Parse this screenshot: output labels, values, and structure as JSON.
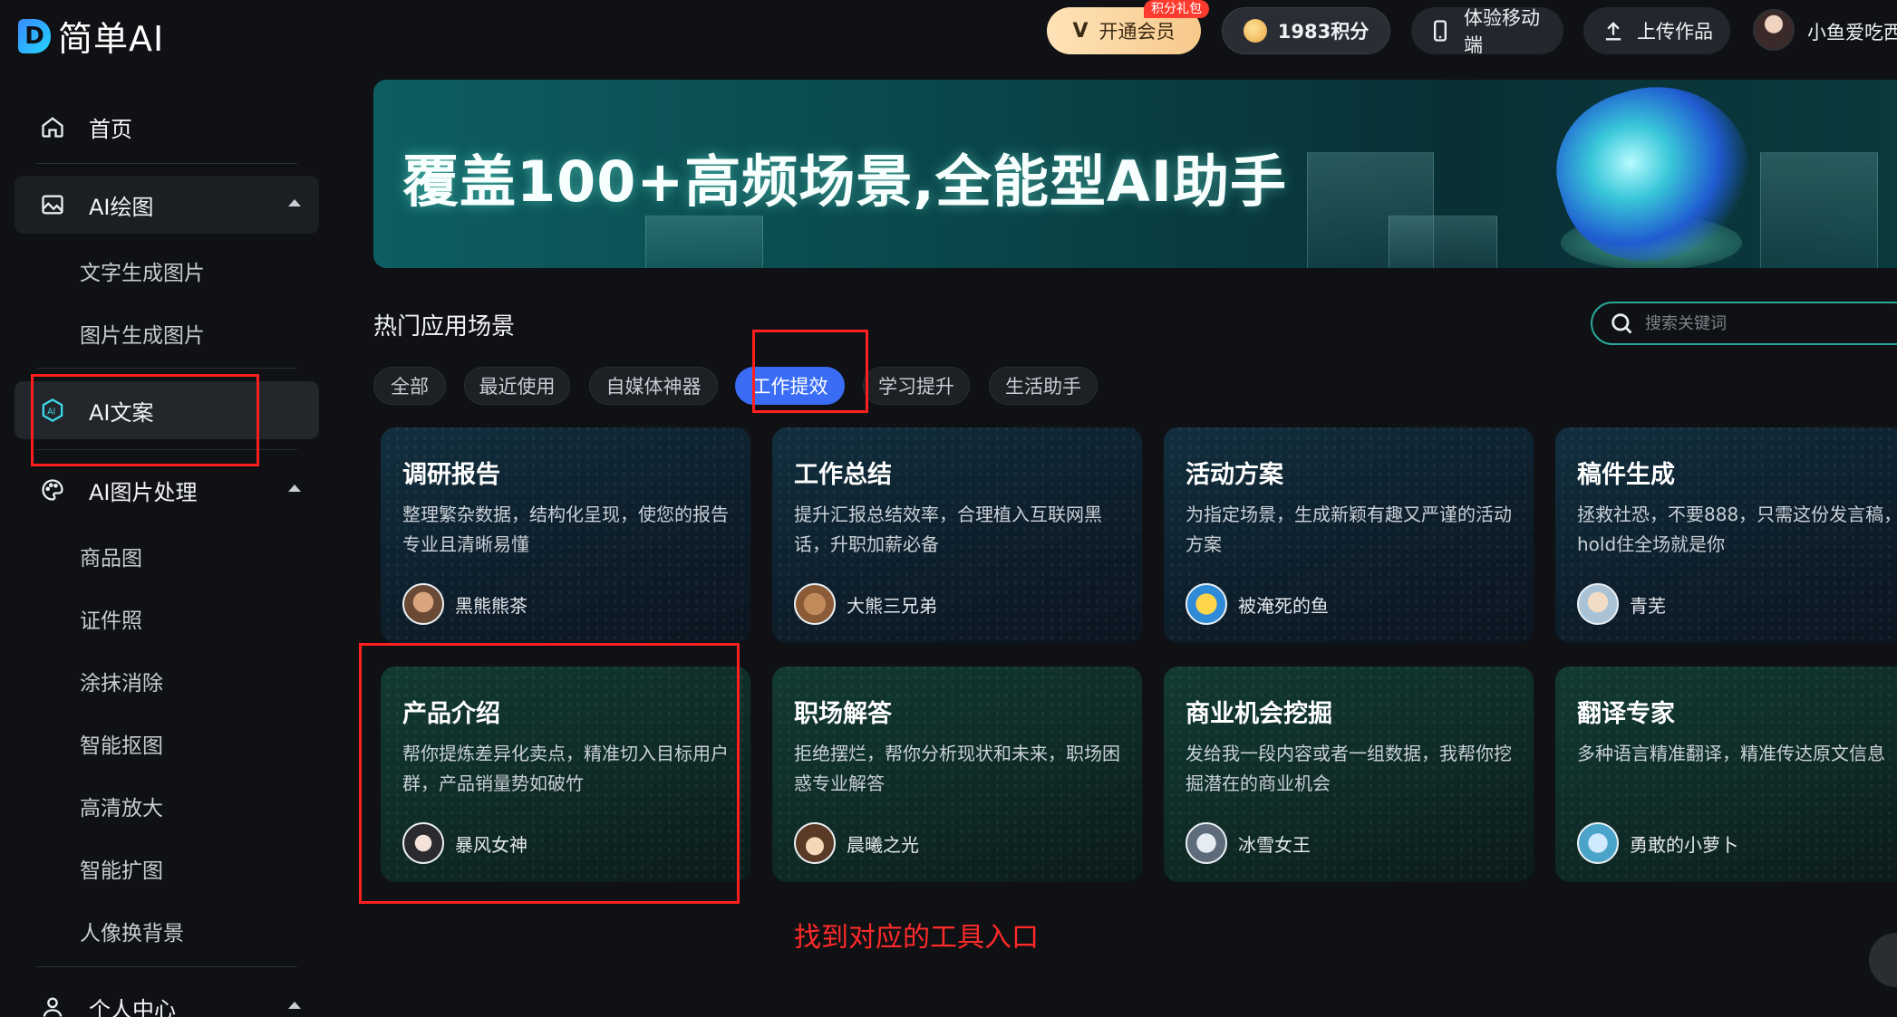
{
  "logo": {
    "mark": "D",
    "text": "简单AI"
  },
  "topbar": {
    "vip_label": "开通会员",
    "gift_badge": "积分礼包",
    "points_label": "1983积分",
    "mobile_label": "体验移动端",
    "upload_label": "上传作品",
    "username": "小鱼爱吃西"
  },
  "sidebar": {
    "home": "首页",
    "ai_draw": "AI绘图",
    "ai_draw_items": [
      "文字生成图片",
      "图片生成图片"
    ],
    "ai_copy": "AI文案",
    "ai_image": "AI图片处理",
    "ai_image_items": [
      "商品图",
      "证件照",
      "涂抹消除",
      "智能抠图",
      "高清放大",
      "智能扩图",
      "人像换背景"
    ],
    "personal": "个人中心"
  },
  "banner": {
    "title": "覆盖100+高频场景,全能型AI助手"
  },
  "section": {
    "title": "热门应用场景",
    "search_placeholder": "搜索关键词",
    "tabs": [
      "全部",
      "最近使用",
      "自媒体神器",
      "工作提效",
      "学习提升",
      "生活助手"
    ],
    "active_tab": "工作提效"
  },
  "cards": [
    {
      "title": "调研报告",
      "desc": "整理繁杂数据，结构化呈现，使您的报告专业且清晰易懂",
      "author": "黑熊熊茶"
    },
    {
      "title": "工作总结",
      "desc": "提升汇报总结效率，合理植入互联网黑话，升职加薪必备",
      "author": "大熊三兄弟"
    },
    {
      "title": "活动方案",
      "desc": "为指定场景，生成新颖有趣又严谨的活动方案",
      "author": "被淹死的鱼"
    },
    {
      "title": "稿件生成",
      "desc": "拯救社恐，不要888，只需这份发言稿，hold住全场就是你",
      "author": "青芜"
    },
    {
      "title": "产品介绍",
      "desc": "帮你提炼差异化卖点，精准切入目标用户群，产品销量势如破竹",
      "author": "暴风女神"
    },
    {
      "title": "职场解答",
      "desc": "拒绝摆烂，帮你分析现状和未来，职场困惑专业解答",
      "author": "晨曦之光"
    },
    {
      "title": "商业机会挖掘",
      "desc": "发给我一段内容或者一组数据，我帮你挖掘潜在的商业机会",
      "author": "冰雪女王"
    },
    {
      "title": "翻译专家",
      "desc": "多种语言精准翻译，精准传达原文信息",
      "author": "勇敢的小萝卜"
    }
  ],
  "annotation": {
    "note": "找到对应的工具入口"
  },
  "colors": {
    "accent": "#3b6cf6",
    "highlight_red": "#ff1f1f",
    "teal": "#2aa79a"
  }
}
